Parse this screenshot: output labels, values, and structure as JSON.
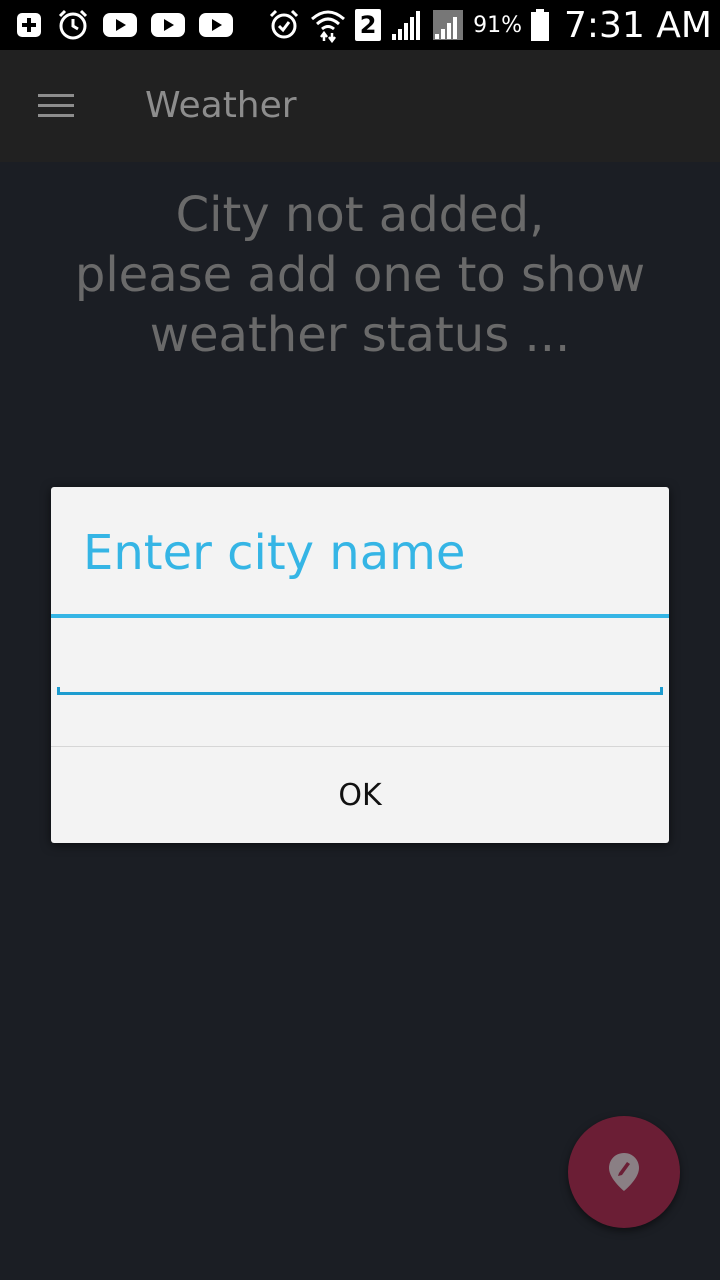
{
  "status_bar": {
    "left_icons": [
      "add-icon",
      "alarm-icon",
      "youtube-icon",
      "youtube-icon",
      "youtube-icon"
    ],
    "right_icons": [
      "alarm-icon",
      "wifi-icon",
      "sim-icon",
      "signal-icon",
      "signal-icon"
    ],
    "sim_number": "2",
    "battery_percent": "91%",
    "time": "7:31 AM"
  },
  "app_bar": {
    "menu_icon": "hamburger-menu-icon",
    "title": "Weather"
  },
  "main": {
    "empty_message_lines": [
      "City not added,",
      "please add one to show",
      "weather status ..."
    ]
  },
  "dialog": {
    "title": "Enter city name",
    "input_value": "",
    "ok_label": "OK",
    "accent_color": "#35b5e5"
  },
  "fab": {
    "icon": "location-pin-icon",
    "color": "#6b1e35"
  },
  "colors": {
    "background": "#1b1e24",
    "app_bar": "#212121",
    "dialog_bg": "#f3f3f3"
  }
}
